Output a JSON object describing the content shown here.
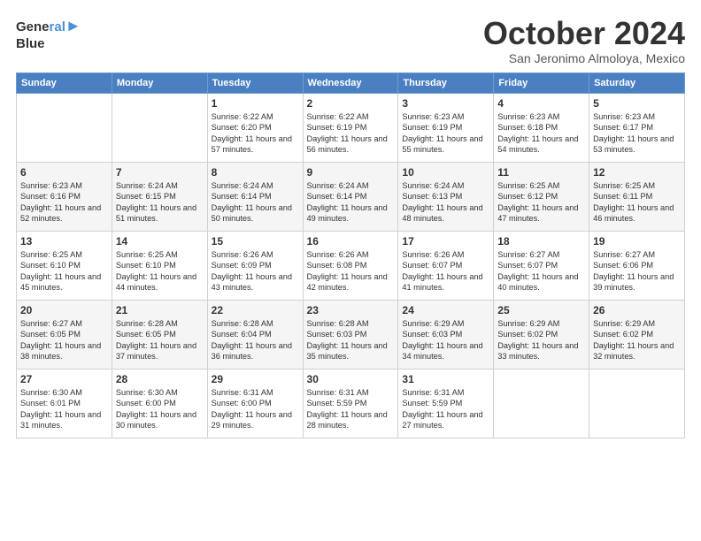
{
  "header": {
    "logo_line1": "General",
    "logo_line2": "Blue",
    "month": "October 2024",
    "location": "San Jeronimo Almoloya, Mexico"
  },
  "days_of_week": [
    "Sunday",
    "Monday",
    "Tuesday",
    "Wednesday",
    "Thursday",
    "Friday",
    "Saturday"
  ],
  "weeks": [
    [
      {
        "day": "",
        "info": ""
      },
      {
        "day": "",
        "info": ""
      },
      {
        "day": "1",
        "info": "Sunrise: 6:22 AM\nSunset: 6:20 PM\nDaylight: 11 hours and 57 minutes."
      },
      {
        "day": "2",
        "info": "Sunrise: 6:22 AM\nSunset: 6:19 PM\nDaylight: 11 hours and 56 minutes."
      },
      {
        "day": "3",
        "info": "Sunrise: 6:23 AM\nSunset: 6:19 PM\nDaylight: 11 hours and 55 minutes."
      },
      {
        "day": "4",
        "info": "Sunrise: 6:23 AM\nSunset: 6:18 PM\nDaylight: 11 hours and 54 minutes."
      },
      {
        "day": "5",
        "info": "Sunrise: 6:23 AM\nSunset: 6:17 PM\nDaylight: 11 hours and 53 minutes."
      }
    ],
    [
      {
        "day": "6",
        "info": "Sunrise: 6:23 AM\nSunset: 6:16 PM\nDaylight: 11 hours and 52 minutes."
      },
      {
        "day": "7",
        "info": "Sunrise: 6:24 AM\nSunset: 6:15 PM\nDaylight: 11 hours and 51 minutes."
      },
      {
        "day": "8",
        "info": "Sunrise: 6:24 AM\nSunset: 6:14 PM\nDaylight: 11 hours and 50 minutes."
      },
      {
        "day": "9",
        "info": "Sunrise: 6:24 AM\nSunset: 6:14 PM\nDaylight: 11 hours and 49 minutes."
      },
      {
        "day": "10",
        "info": "Sunrise: 6:24 AM\nSunset: 6:13 PM\nDaylight: 11 hours and 48 minutes."
      },
      {
        "day": "11",
        "info": "Sunrise: 6:25 AM\nSunset: 6:12 PM\nDaylight: 11 hours and 47 minutes."
      },
      {
        "day": "12",
        "info": "Sunrise: 6:25 AM\nSunset: 6:11 PM\nDaylight: 11 hours and 46 minutes."
      }
    ],
    [
      {
        "day": "13",
        "info": "Sunrise: 6:25 AM\nSunset: 6:10 PM\nDaylight: 11 hours and 45 minutes."
      },
      {
        "day": "14",
        "info": "Sunrise: 6:25 AM\nSunset: 6:10 PM\nDaylight: 11 hours and 44 minutes."
      },
      {
        "day": "15",
        "info": "Sunrise: 6:26 AM\nSunset: 6:09 PM\nDaylight: 11 hours and 43 minutes."
      },
      {
        "day": "16",
        "info": "Sunrise: 6:26 AM\nSunset: 6:08 PM\nDaylight: 11 hours and 42 minutes."
      },
      {
        "day": "17",
        "info": "Sunrise: 6:26 AM\nSunset: 6:07 PM\nDaylight: 11 hours and 41 minutes."
      },
      {
        "day": "18",
        "info": "Sunrise: 6:27 AM\nSunset: 6:07 PM\nDaylight: 11 hours and 40 minutes."
      },
      {
        "day": "19",
        "info": "Sunrise: 6:27 AM\nSunset: 6:06 PM\nDaylight: 11 hours and 39 minutes."
      }
    ],
    [
      {
        "day": "20",
        "info": "Sunrise: 6:27 AM\nSunset: 6:05 PM\nDaylight: 11 hours and 38 minutes."
      },
      {
        "day": "21",
        "info": "Sunrise: 6:28 AM\nSunset: 6:05 PM\nDaylight: 11 hours and 37 minutes."
      },
      {
        "day": "22",
        "info": "Sunrise: 6:28 AM\nSunset: 6:04 PM\nDaylight: 11 hours and 36 minutes."
      },
      {
        "day": "23",
        "info": "Sunrise: 6:28 AM\nSunset: 6:03 PM\nDaylight: 11 hours and 35 minutes."
      },
      {
        "day": "24",
        "info": "Sunrise: 6:29 AM\nSunset: 6:03 PM\nDaylight: 11 hours and 34 minutes."
      },
      {
        "day": "25",
        "info": "Sunrise: 6:29 AM\nSunset: 6:02 PM\nDaylight: 11 hours and 33 minutes."
      },
      {
        "day": "26",
        "info": "Sunrise: 6:29 AM\nSunset: 6:02 PM\nDaylight: 11 hours and 32 minutes."
      }
    ],
    [
      {
        "day": "27",
        "info": "Sunrise: 6:30 AM\nSunset: 6:01 PM\nDaylight: 11 hours and 31 minutes."
      },
      {
        "day": "28",
        "info": "Sunrise: 6:30 AM\nSunset: 6:00 PM\nDaylight: 11 hours and 30 minutes."
      },
      {
        "day": "29",
        "info": "Sunrise: 6:31 AM\nSunset: 6:00 PM\nDaylight: 11 hours and 29 minutes."
      },
      {
        "day": "30",
        "info": "Sunrise: 6:31 AM\nSunset: 5:59 PM\nDaylight: 11 hours and 28 minutes."
      },
      {
        "day": "31",
        "info": "Sunrise: 6:31 AM\nSunset: 5:59 PM\nDaylight: 11 hours and 27 minutes."
      },
      {
        "day": "",
        "info": ""
      },
      {
        "day": "",
        "info": ""
      }
    ]
  ]
}
